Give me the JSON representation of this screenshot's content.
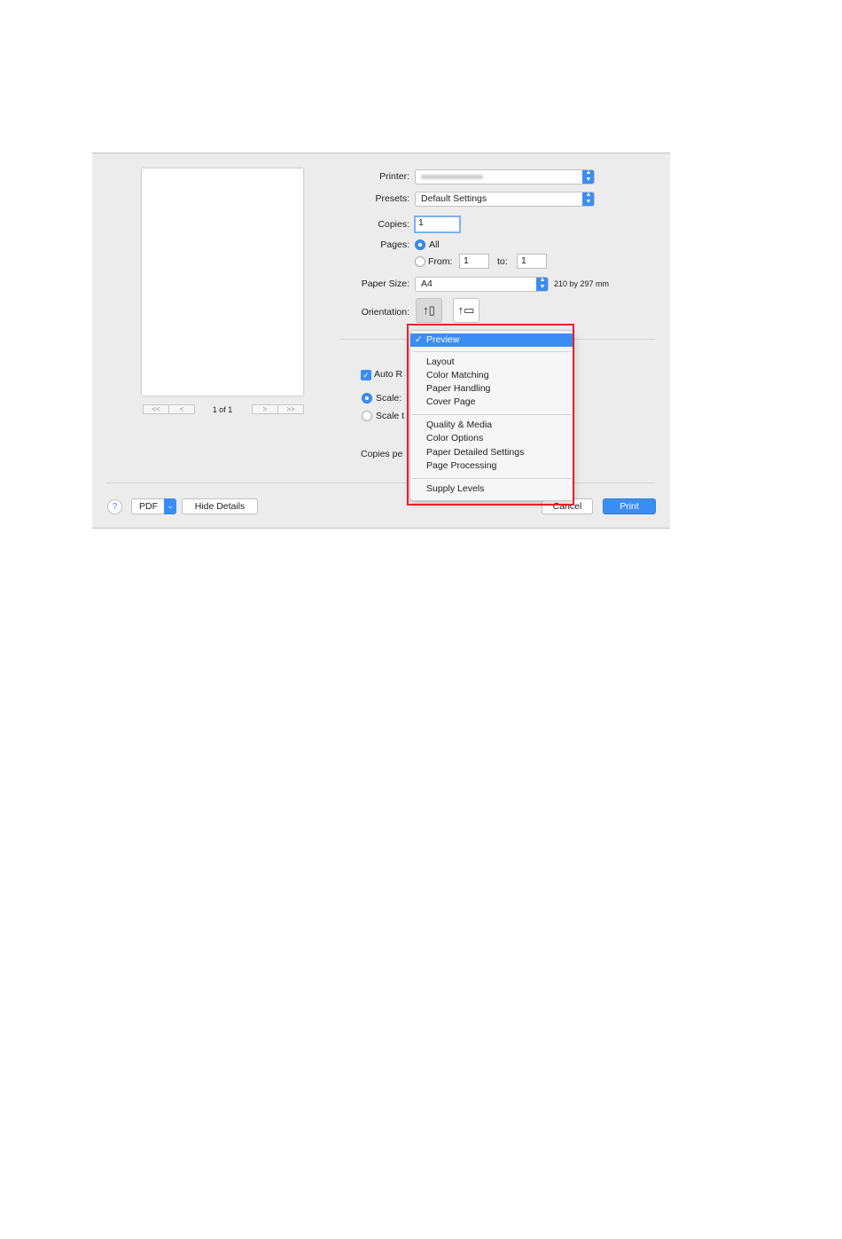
{
  "preview": {
    "page_counter": "1 of 1",
    "nav": {
      "first": "<<",
      "prev": "<",
      "next": ">",
      "last": ">>"
    }
  },
  "printer": {
    "label": "Printer:"
  },
  "presets": {
    "label": "Presets:",
    "value": "Default Settings"
  },
  "copies": {
    "label": "Copies:",
    "value": "1"
  },
  "pages": {
    "label": "Pages:",
    "all_label": "All",
    "from_label": "From:",
    "from_value": "1",
    "to_label": "to:",
    "to_value": "1"
  },
  "paper_size": {
    "label": "Paper Size:",
    "value": "A4",
    "dimensions": "210 by 297 mm"
  },
  "orientation": {
    "label": "Orientation:"
  },
  "background_options": {
    "auto_rotate": "Auto R",
    "scale": "Scale:",
    "scale_to_fit": "Scale t",
    "copies_per": "Copies pe"
  },
  "menu": {
    "items": [
      "Preview",
      "Layout",
      "Color Matching",
      "Paper Handling",
      "Cover Page",
      "Quality & Media",
      "Color Options",
      "Paper Detailed Settings",
      "Page Processing",
      "Supply Levels"
    ],
    "check_glyph": "✓"
  },
  "footer": {
    "help": "?",
    "pdf": "PDF",
    "hide_details": "Hide Details",
    "cancel": "Cancel",
    "print": "Print"
  },
  "colors": {
    "accent": "#3b8df3",
    "highlight_box": "#e5202a",
    "dialog_bg": "#ececec"
  }
}
